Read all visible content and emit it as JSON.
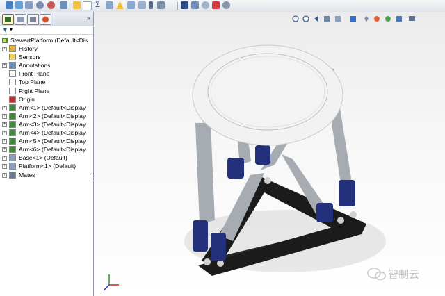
{
  "feature_tree": {
    "root": "StewartPlatform  (Default<Dis",
    "items": [
      {
        "label": "History",
        "expander": true
      },
      {
        "label": "Sensors",
        "expander": false
      },
      {
        "label": "Annotations",
        "expander": true
      },
      {
        "label": "Front Plane",
        "expander": false
      },
      {
        "label": "Top Plane",
        "expander": false
      },
      {
        "label": "Right Plane",
        "expander": false
      },
      {
        "label": "Origin",
        "expander": false
      },
      {
        "label": "Arm<1> (Default<Display",
        "expander": true
      },
      {
        "label": "Arm<2> (Default<Display",
        "expander": true
      },
      {
        "label": "Arm<3> (Default<Display",
        "expander": true
      },
      {
        "label": "Arm<4> (Default<Display",
        "expander": true
      },
      {
        "label": "Arm<5> (Default<Display",
        "expander": true
      },
      {
        "label": "Arm<6> (Default<Display",
        "expander": true
      },
      {
        "label": "Base<1> (Default)",
        "expander": true
      },
      {
        "label": "Platform<1> (Default)",
        "expander": true
      },
      {
        "label": "Mates",
        "expander": true
      }
    ]
  },
  "panel": {
    "collapse_glyph": "»",
    "filter_glyph": "▾"
  },
  "watermark": {
    "text": "智制云"
  },
  "colors": {
    "arm_blue": "#23317c",
    "base_black": "#1b1b1b",
    "ring_white": "#f2f2f2",
    "cylinder_gray": "#a7acb2"
  }
}
